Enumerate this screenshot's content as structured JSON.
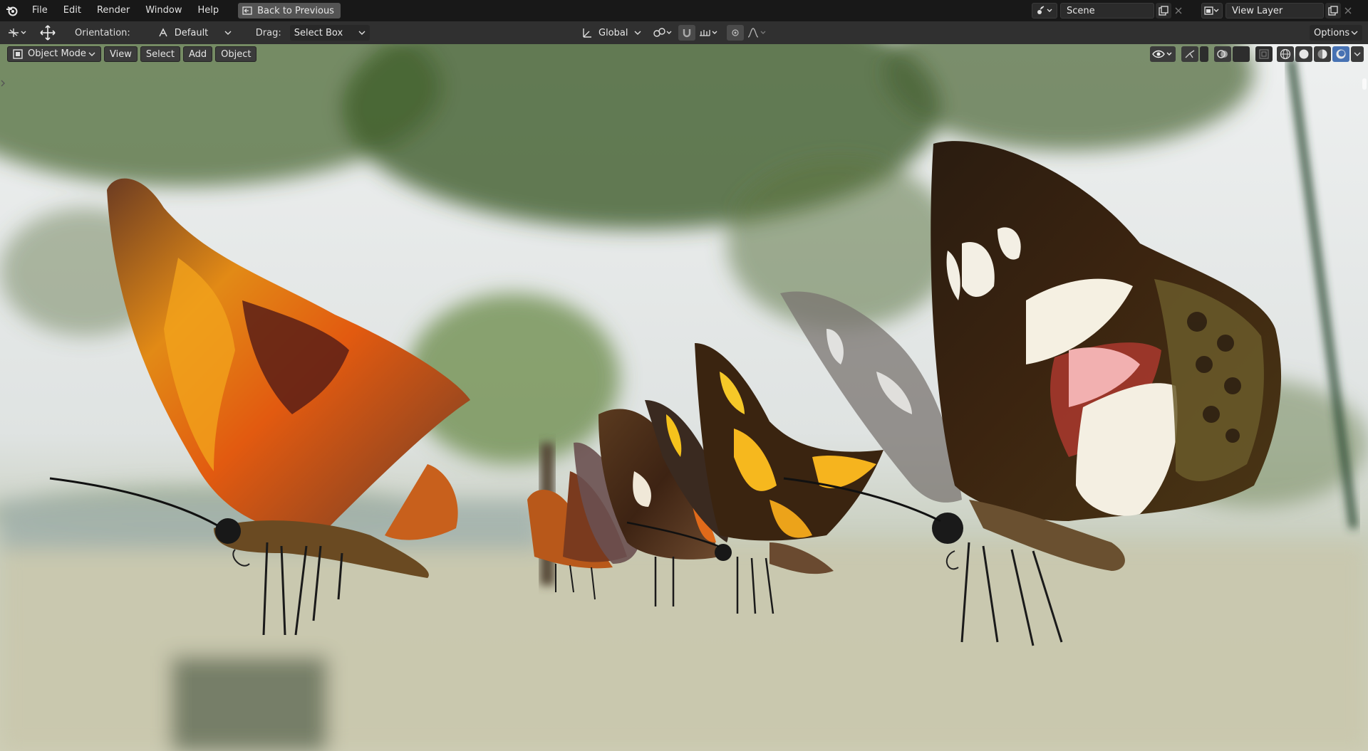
{
  "menu": {
    "items": [
      "File",
      "Edit",
      "Render",
      "Window",
      "Help"
    ],
    "back_button_label": "Back to Previous"
  },
  "scene": {
    "label": "Scene"
  },
  "view_layer": {
    "label": "View Layer"
  },
  "toolbar": {
    "orientation_label": "Orientation:",
    "orientation_value": "Default",
    "drag_label": "Drag:",
    "drag_value": "Select Box",
    "transform_space": "Global",
    "options_label": "Options"
  },
  "viewport_header": {
    "mode": "Object Mode",
    "view": "View",
    "select": "Select",
    "add": "Add",
    "object": "Object"
  },
  "colors": {
    "accent": "#4772b3",
    "top_bar": "#181818",
    "toolbar": "#303030"
  }
}
